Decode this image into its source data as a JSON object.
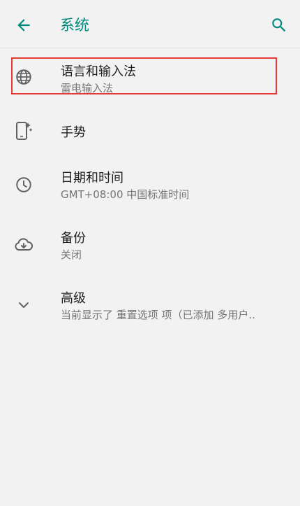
{
  "appbar": {
    "title": "系统",
    "back_icon": "arrow-back-icon",
    "search_icon": "search-icon"
  },
  "items": [
    {
      "label": "语言和输入法",
      "sub": "雷电输入法",
      "icon": "globe-icon"
    },
    {
      "label": "手势",
      "sub": "",
      "icon": "gesture-phone-icon"
    },
    {
      "label": "日期和时间",
      "sub": "GMT+08:00 中国标准时间",
      "icon": "clock-icon"
    },
    {
      "label": "备份",
      "sub": "关闭",
      "icon": "cloud-backup-icon"
    },
    {
      "label": "高级",
      "sub": "当前显示了 重置选项 项（已添加 多用户..",
      "icon": "chevron-down-icon"
    }
  ],
  "colors": {
    "accent": "#00897b",
    "highlight": "#e53935",
    "icon": "#616161"
  }
}
